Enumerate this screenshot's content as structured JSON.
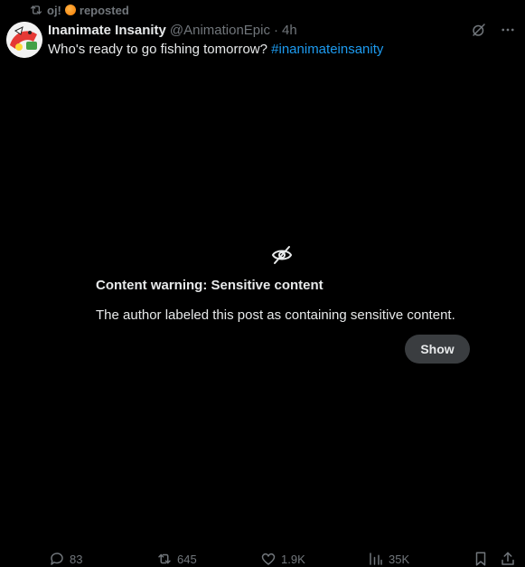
{
  "repost": {
    "user": "oj!",
    "label": "reposted",
    "icon": "repost-icon"
  },
  "post": {
    "author_name": "Inanimate Insanity",
    "author_handle": "@AnimationEpic",
    "separator": "·",
    "time": "4h",
    "text_prefix": "Who's ready to go fishing tomorrow? ",
    "hashtag": "#inanimateinsanity",
    "top_icons": [
      "grok-icon",
      "more-icon"
    ]
  },
  "warning": {
    "icon": "eye-slash-icon",
    "title": "Content warning: Sensitive content",
    "description": "The author labeled this post as containing sensitive content.",
    "button": "Show"
  },
  "actions": {
    "replies": "83",
    "reposts": "645",
    "likes": "1.9K",
    "views": "35K",
    "icons": [
      "reply-icon",
      "repost-icon",
      "like-icon",
      "views-icon",
      "bookmark-icon",
      "share-icon"
    ]
  },
  "colors": {
    "background": "#000000",
    "text": "#e7e9ea",
    "muted": "#71767b",
    "accent": "#1d9bf0",
    "button_bg": "#3a3d40"
  }
}
